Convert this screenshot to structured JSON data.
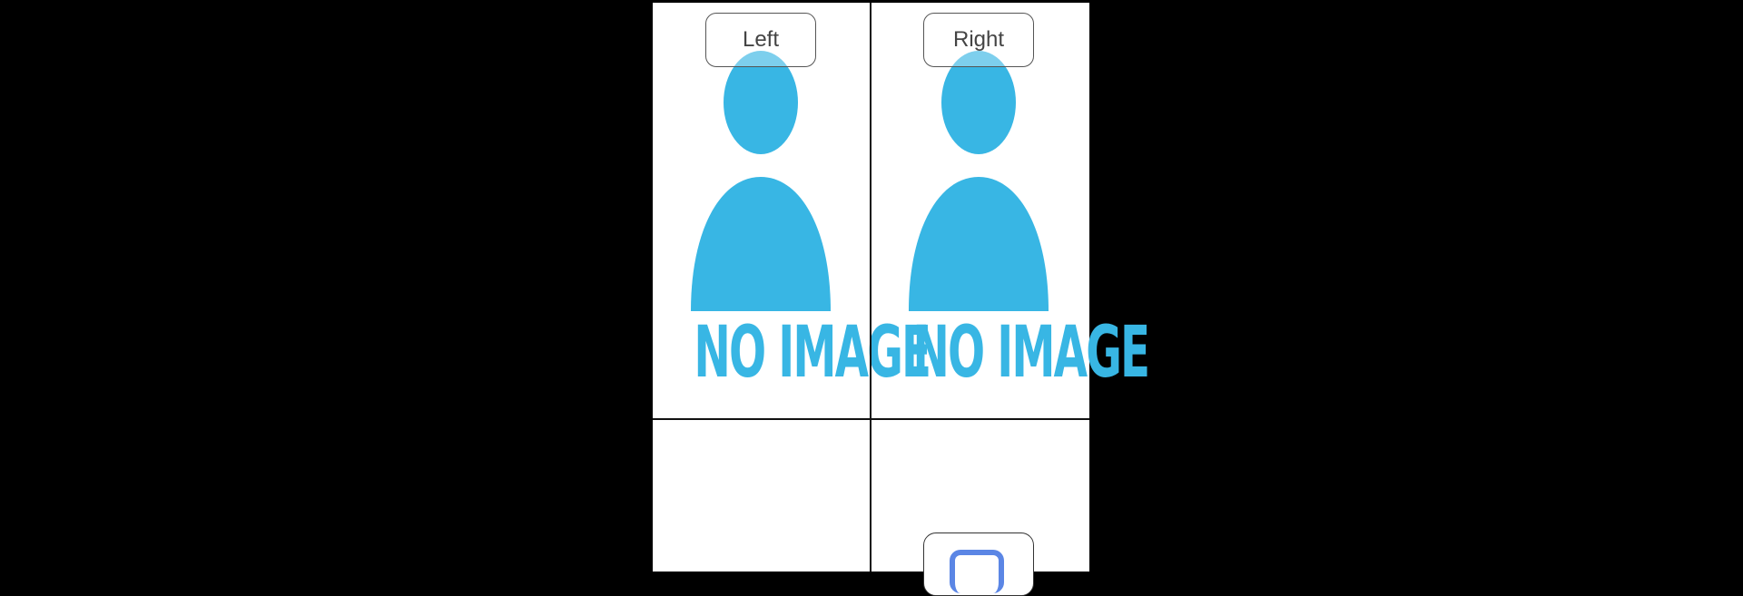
{
  "colors": {
    "background": "#000000",
    "panel": "#ffffff",
    "grid_line": "#111111",
    "placeholder": "#38b6e4",
    "action_icon": "#5b86e5"
  },
  "grid": {
    "cells": [
      {
        "image": {
          "icon": "person-silhouette-icon",
          "text": "NO IMAGE"
        },
        "label": "Left"
      },
      {
        "image": {
          "icon": "person-silhouette-icon",
          "text": "NO IMAGE"
        },
        "label": "Right"
      }
    ],
    "bottom": {
      "action_button": {
        "icon": "rounded-square-icon"
      }
    }
  }
}
